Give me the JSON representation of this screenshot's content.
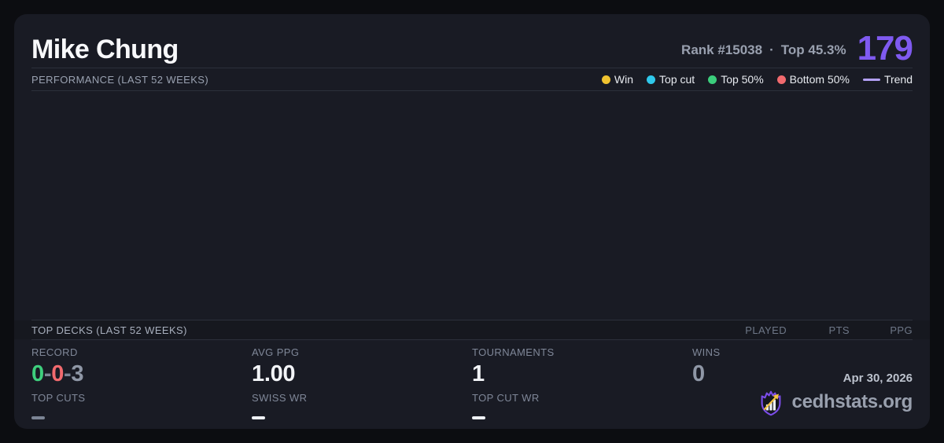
{
  "colors": {
    "accent_purple": "#7f5af0",
    "record_win_green": "#3ecf7d",
    "record_loss_red": "#f16a6e",
    "muted_value_gray": "#8f97a6",
    "value_white": "#f2f4f7",
    "card_background": "#191b24",
    "page_background": "#0c0d11",
    "brand_shield_purple": "#7c4dea",
    "brand_arrow_yellow": "#f5c242"
  },
  "player": {
    "name": "Mike Chung",
    "rank_label": "Rank #15038",
    "separator": "·",
    "top_percent_label": "Top 45.3%",
    "score": "179"
  },
  "performance": {
    "title": "PERFORMANCE (LAST 52 WEEKS)",
    "legend": [
      {
        "label": "Win",
        "color": "#f0c330",
        "swatch": "dot"
      },
      {
        "label": "Top cut",
        "color": "#2fc8eb",
        "swatch": "dot"
      },
      {
        "label": "Top 50%",
        "color": "#3bce7c",
        "swatch": "dot"
      },
      {
        "label": "Bottom 50%",
        "color": "#f16a6e",
        "swatch": "dot"
      },
      {
        "label": "Trend",
        "color": "#b3a0f5",
        "swatch": "line"
      }
    ],
    "chart_empty": true
  },
  "top_decks": {
    "title": "TOP DECKS (LAST 52 WEEKS)",
    "columns": [
      "PLAYED",
      "PTS",
      "PPG"
    ],
    "rows": []
  },
  "stats": {
    "record": {
      "label": "RECORD",
      "wins": "0",
      "losses": "0",
      "draws": "3",
      "separator": "-"
    },
    "avg_ppg": {
      "label": "AVG PPG",
      "value": "1.00"
    },
    "tournaments": {
      "label": "TOURNAMENTS",
      "value": "1"
    },
    "wins": {
      "label": "WINS",
      "value": "0"
    },
    "top_cuts": {
      "label": "TOP CUTS",
      "value": "—"
    },
    "swiss_wr": {
      "label": "SWISS WR",
      "value": "—"
    },
    "top_cut_wr": {
      "label": "TOP CUT WR",
      "value": "—"
    }
  },
  "footer": {
    "date": "Apr 30, 2026",
    "site": "cedhstats.org"
  }
}
